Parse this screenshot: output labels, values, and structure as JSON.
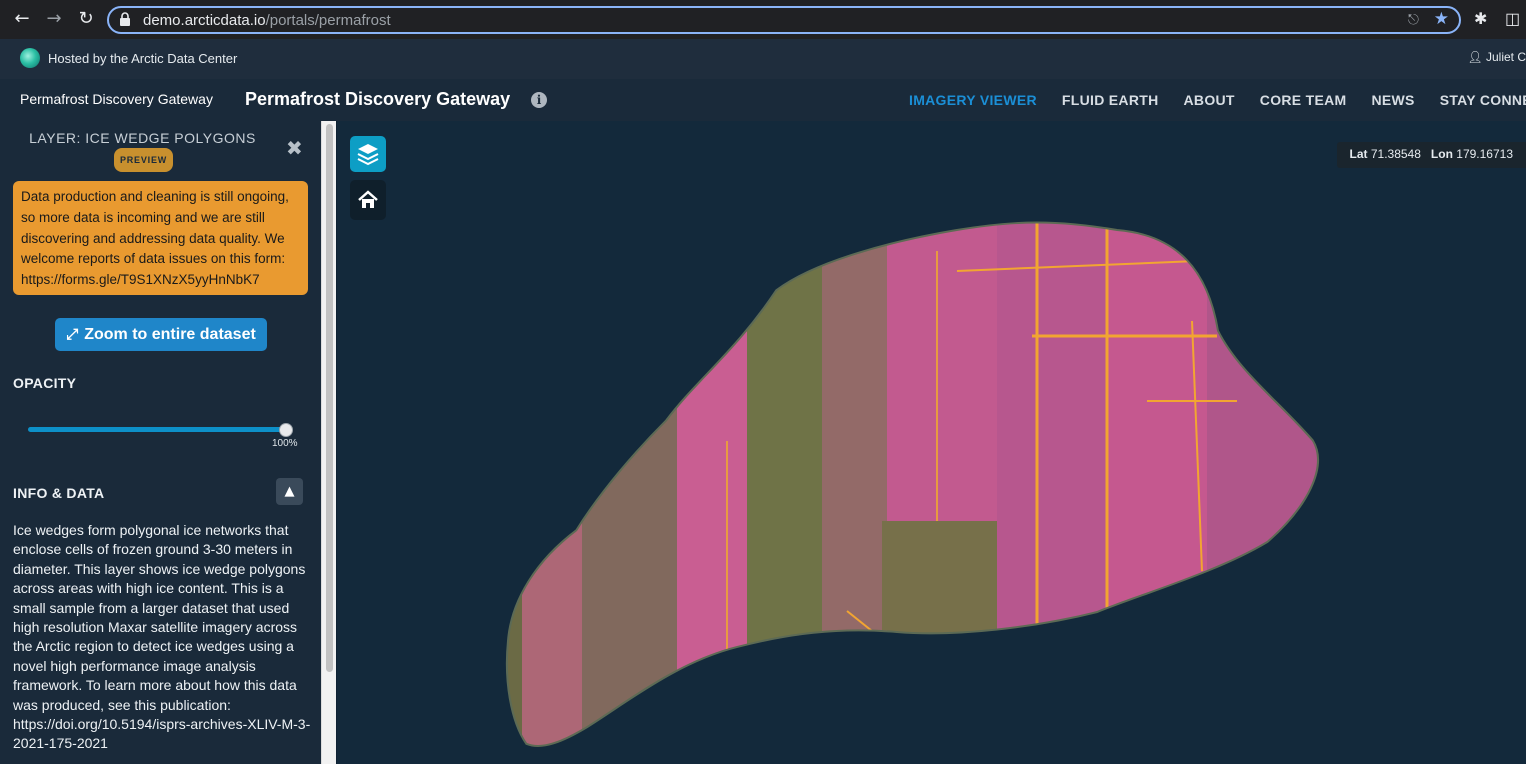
{
  "browser": {
    "url_host": "demo.arcticdata.io",
    "url_path": "/portals/permafrost"
  },
  "hosted_bar": {
    "text": "Hosted by the Arctic Data Center",
    "user": "Juliet C"
  },
  "header": {
    "brand_alt": "Permafrost Discovery Gateway",
    "title": "Permafrost Discovery Gateway",
    "nav": [
      {
        "label": "IMAGERY VIEWER",
        "active": true
      },
      {
        "label": "FLUID EARTH",
        "active": false
      },
      {
        "label": "ABOUT",
        "active": false
      },
      {
        "label": "CORE TEAM",
        "active": false
      },
      {
        "label": "NEWS",
        "active": false
      },
      {
        "label": "STAY CONNECTED",
        "active": false
      }
    ]
  },
  "sidebar": {
    "layer_title": "LAYER: ICE WEDGE POLYGONS",
    "badge": "PREVIEW",
    "notice": "Data production and cleaning is still ongoing, so more data is incoming and we are still discovering and addressing data quality. We welcome reports of data issues on this form: https://forms.gle/T9S1XNzX5yyHnNbK7",
    "zoom_button": "Zoom to entire dataset",
    "opacity_label": "OPACITY",
    "opacity_value": "100%",
    "opacity_fraction": 1.0,
    "info_label": "INFO & DATA",
    "info_text": "Ice wedges form polygonal ice networks that enclose cells of frozen ground 3-30 meters in diameter. This layer shows ice wedge polygons across areas with high ice content. This is a small sample from a larger dataset that used high resolution Maxar satellite imagery across the Arctic region to detect ice wedges using a novel high performance image analysis framework. To learn more about how this data was produced, see this publication: https://doi.org/10.5194/isprs-archives-XLIV-M-3-2021-175-2021"
  },
  "map": {
    "lat_label": "Lat",
    "lat_value": "71.38548",
    "lon_label": "Lon",
    "lon_value": "179.16713"
  },
  "icons": {
    "layers": "layers-icon",
    "home": "home-icon",
    "close": "close-icon",
    "expand": "expand-icon",
    "chevron_up": "chevron-up-icon",
    "info": "info-icon"
  },
  "colors": {
    "accent": "#1b8fd6",
    "notice_bg": "#e99a30",
    "panel_bg": "#1a2a3a",
    "layers_btn": "#0d9ec5"
  }
}
